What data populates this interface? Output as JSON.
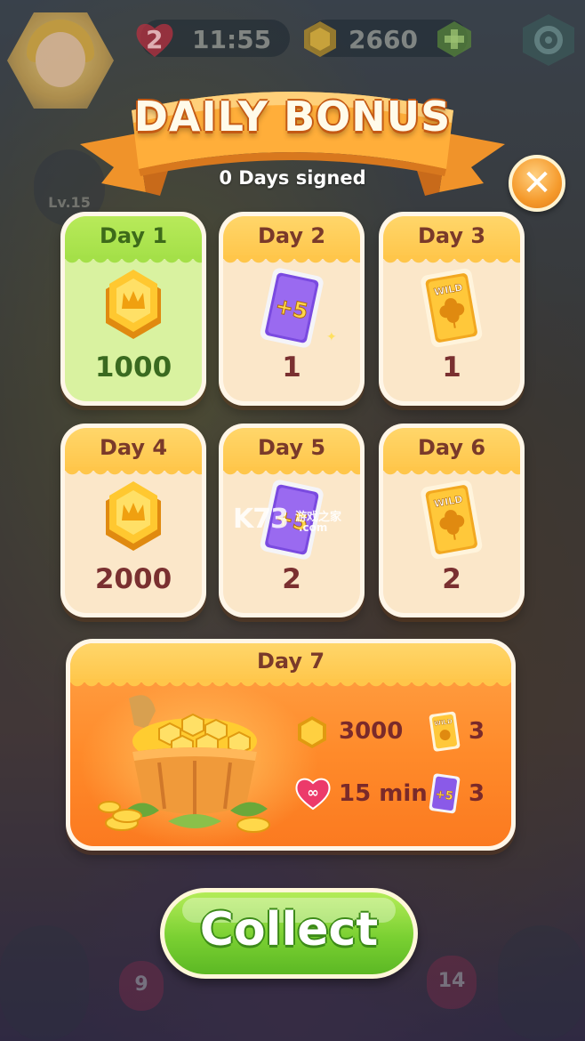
{
  "hud": {
    "lives": "2",
    "timer": "11:55",
    "coins": "2660"
  },
  "header": {
    "title": "DAILY BONUS",
    "subtitle": "0 Days signed"
  },
  "days": [
    {
      "label": "Day 1",
      "reward": "coin-icon",
      "amount": "1000",
      "active": true
    },
    {
      "label": "Day 2",
      "reward": "plus5-moves-card-icon",
      "amount": "1",
      "active": false
    },
    {
      "label": "Day 3",
      "reward": "wild-card-icon",
      "amount": "1",
      "active": false
    },
    {
      "label": "Day 4",
      "reward": "coin-icon",
      "amount": "2000",
      "active": false
    },
    {
      "label": "Day 5",
      "reward": "plus5-moves-card-icon",
      "amount": "2",
      "active": false
    },
    {
      "label": "Day 6",
      "reward": "wild-card-icon",
      "amount": "2",
      "active": false
    }
  ],
  "day7": {
    "label": "Day 7",
    "coins": "3000",
    "wild_count": "3",
    "infinite_lives": "15 min",
    "plus5_count": "3",
    "card_text_wild": "WILD",
    "card_text_plus5": "+5"
  },
  "side": {
    "level": "Lv.15",
    "left_bottom_counter": "9",
    "right_bottom_counter": "14"
  },
  "watermark": {
    "logo": "K73",
    "text": "游戏之家",
    "domain": ".com"
  },
  "collect_label": "Collect",
  "close_symbol": "✕",
  "colors": {
    "header_gold": "#ffc64a",
    "active_green": "#a4e048",
    "day7_orange": "#ff8a2a",
    "amount_text": "#7a3030",
    "collect_green": "#7ad032"
  }
}
